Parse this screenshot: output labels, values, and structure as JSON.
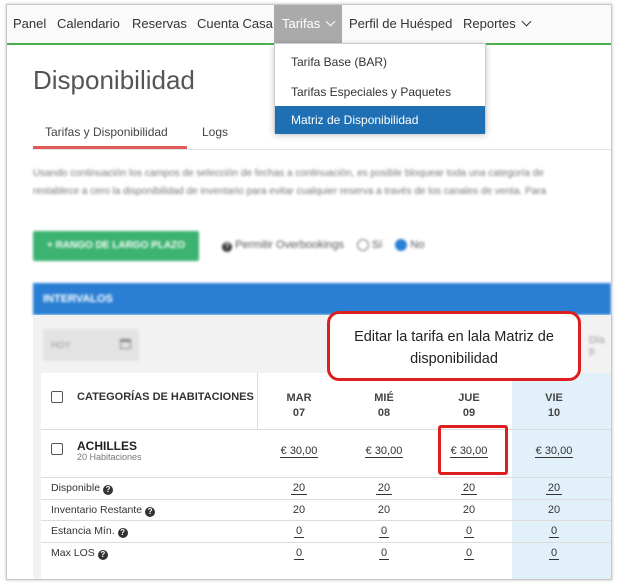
{
  "nav": {
    "items": [
      "Panel",
      "Calendario",
      "Reservas",
      "Cuenta Casa"
    ],
    "active": "Tarifas",
    "after": [
      "Perfil de Huésped",
      "Reportes"
    ]
  },
  "dropdown": {
    "items": [
      "Tarifa Base (BAR)",
      "Tarifas Especiales y Paquetes",
      "Matriz de Disponibilidad"
    ],
    "selected_index": 2
  },
  "page": {
    "title": "Disponibilidad",
    "tabs": [
      "Tarifas y Disponibilidad",
      "Logs"
    ],
    "description_line1": "Usando continuación los campos de selección de fechas a continuación, es posible bloquear toda una categoría de",
    "description_line2": "restablece a cero la disponibilidad de inventario para evitar cualquier reserva a través de los canales de venta. Para"
  },
  "controls": {
    "range_button": "+ RANGO DE LARGO PLAZO",
    "overbook_label": "Permitir Overbookings",
    "opt_yes": "Sí",
    "opt_no": "No",
    "selected_option": "No"
  },
  "intervals": {
    "header": "INTERVALOS",
    "date_placeholder": "HOY",
    "dia_label": "Día p"
  },
  "grid": {
    "category_header": "CATEGORÍAS DE HABITACIONES",
    "days": [
      {
        "dow": "MAR",
        "num": "07"
      },
      {
        "dow": "MIÉ",
        "num": "08"
      },
      {
        "dow": "JUE",
        "num": "09"
      },
      {
        "dow": "VIE",
        "num": "10"
      }
    ],
    "room": {
      "name": "ACHILLES",
      "sub": "20 Habitaciones",
      "rates": [
        "€ 30,00",
        "€ 30,00",
        "€ 30,00",
        "€ 30,00"
      ]
    },
    "rows": [
      {
        "label": "Disponible",
        "values": [
          "20",
          "20",
          "20",
          "20"
        ]
      },
      {
        "label": "Inventario Restante",
        "values": [
          "20",
          "20",
          "20",
          "20"
        ]
      },
      {
        "label": "Estancia Mín.",
        "values": [
          "0",
          "0",
          "0",
          "0"
        ]
      },
      {
        "label": "Max LOS",
        "values": [
          "0",
          "0",
          "0",
          "0"
        ]
      }
    ]
  },
  "callout": {
    "text": "Editar la tarifa en lala Matriz de disponibilidad"
  },
  "colors": {
    "accent_green": "#4caf50",
    "primary_blue": "#2a7fd4",
    "highlight_red": "#dd1f1f",
    "tab_underline": "#e05a5a"
  }
}
